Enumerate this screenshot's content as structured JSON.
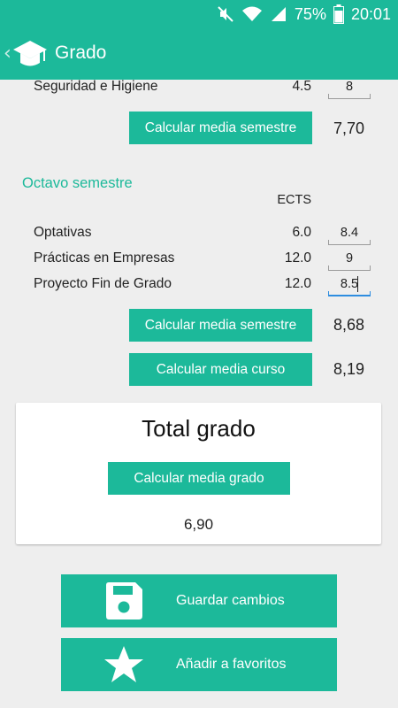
{
  "status_bar": {
    "battery": "75%",
    "time": "20:01"
  },
  "action_bar": {
    "title": "Grado"
  },
  "seventh": {
    "subject": {
      "name": "Seguridad e Higiene",
      "ects": "4.5",
      "grade": "8"
    },
    "calc_button": "Calcular media semestre",
    "result": "7,70"
  },
  "eighth": {
    "title": "Octavo semestre",
    "ects_header": "ECTS",
    "subjects": [
      {
        "name": "Optativas",
        "ects": "6.0",
        "grade": "8.4"
      },
      {
        "name": "Prácticas en Empresas",
        "ects": "12.0",
        "grade": "9"
      },
      {
        "name": "Proyecto Fin de Grado",
        "ects": "12.0",
        "grade": "8.5"
      }
    ],
    "calc_semester_button": "Calcular media semestre",
    "semester_result": "8,68",
    "calc_course_button": "Calcular media curso",
    "course_result": "8,19"
  },
  "total": {
    "title": "Total grado",
    "calc_button": "Calcular media grado",
    "result": "6,90"
  },
  "actions": {
    "save_label": "Guardar cambios",
    "save_icon": "floppy-disk-icon",
    "favorite_label": "Añadir a favoritos",
    "favorite_icon": "star-icon"
  },
  "colors": {
    "accent": "#1cb99a",
    "focus": "#2e8de0"
  }
}
